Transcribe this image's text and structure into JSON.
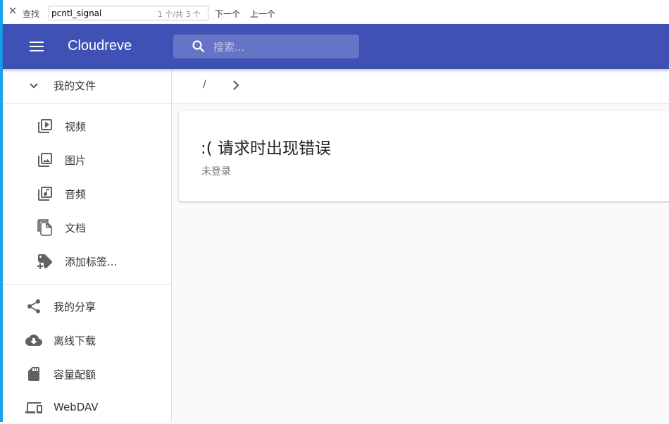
{
  "find_bar": {
    "label": "查找",
    "query": "pcntl_signal",
    "match_count": "1 个/共 3 个",
    "next_label": "下一个",
    "prev_label": "上一个"
  },
  "app_bar": {
    "title": "Cloudreve",
    "search_placeholder": "搜索...",
    "color": "#3f51b5"
  },
  "sidebar": {
    "my_files": {
      "label": "我的文件",
      "icon": "chevron-down-icon"
    },
    "file_types": [
      {
        "label": "视频",
        "icon": "video-library-icon"
      },
      {
        "label": "图片",
        "icon": "photo-library-icon"
      },
      {
        "label": "音频",
        "icon": "library-music-icon"
      },
      {
        "label": "文档",
        "icon": "file-copy-icon"
      },
      {
        "label": "添加标签...",
        "icon": "add-tag-icon"
      }
    ],
    "bottom_items": [
      {
        "label": "我的分享",
        "icon": "share-icon"
      },
      {
        "label": "离线下载",
        "icon": "cloud-download-icon"
      },
      {
        "label": "容量配额",
        "icon": "sd-storage-icon"
      },
      {
        "label": "WebDAV",
        "icon": "devices-icon"
      }
    ]
  },
  "breadcrumb": {
    "root": "/"
  },
  "error_card": {
    "title": ":( 请求时出现错误",
    "message": "未登录"
  }
}
